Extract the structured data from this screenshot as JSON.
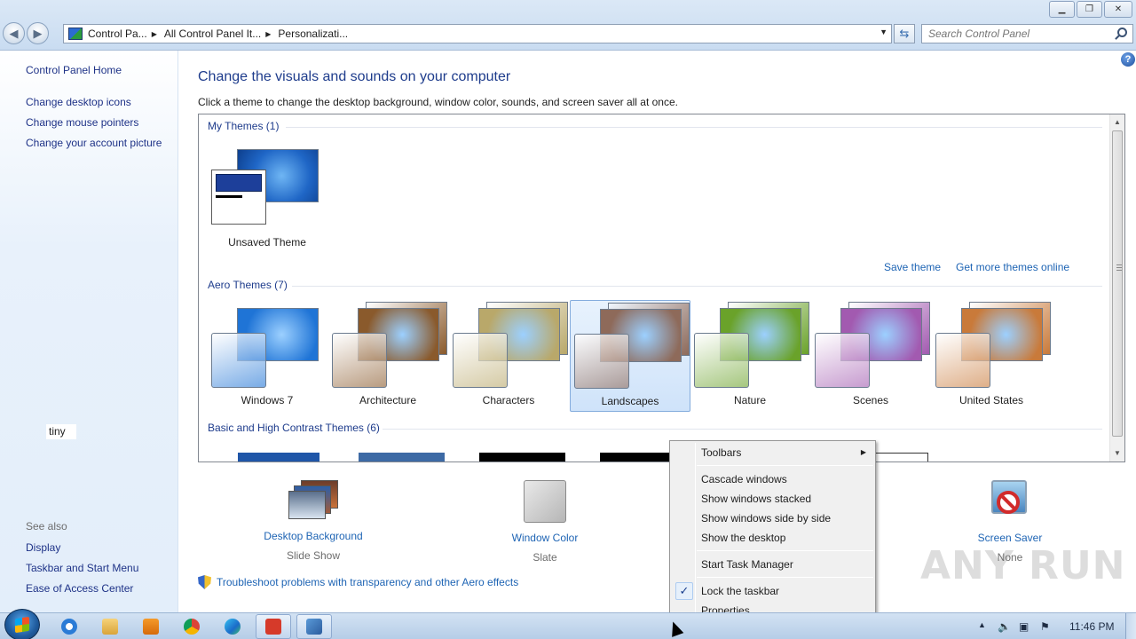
{
  "window": {
    "title_buttons": [
      "minimize",
      "maximize",
      "close"
    ]
  },
  "address": {
    "crumbs": [
      "Control Pa...",
      "All Control Panel It...",
      "Personalizati..."
    ],
    "search_placeholder": "Search Control Panel"
  },
  "sidebar": {
    "home": "Control Panel Home",
    "tasks": [
      "Change desktop icons",
      "Change mouse pointers",
      "Change your account picture"
    ],
    "tooltip_text": "tiny",
    "see_also_label": "See also",
    "see_also": [
      "Display",
      "Taskbar and Start Menu",
      "Ease of Access Center"
    ]
  },
  "main": {
    "title": "Change the visuals and sounds on your computer",
    "subtitle": "Click a theme to change the desktop background, window color, sounds, and screen saver all at once.",
    "groups": {
      "my_themes": "My Themes (1)",
      "aero_themes": "Aero Themes (7)",
      "basic_themes": "Basic and High Contrast Themes (6)"
    },
    "my_theme_name": "Unsaved Theme",
    "save_theme": "Save theme",
    "get_more": "Get more themes online",
    "aero_themes": [
      {
        "name": "Windows 7",
        "color": "#1f74d6"
      },
      {
        "name": "Architecture",
        "color": "#8a5a2c"
      },
      {
        "name": "Characters",
        "color": "#b9a86a"
      },
      {
        "name": "Landscapes",
        "color": "#8e6a5a",
        "selected": true
      },
      {
        "name": "Nature",
        "color": "#6aa22a"
      },
      {
        "name": "Scenes",
        "color": "#a25ab0"
      },
      {
        "name": "United States",
        "color": "#c97a3a"
      }
    ],
    "bottom": [
      {
        "label": "Desktop Background",
        "value": "Slide Show"
      },
      {
        "label": "Window Color",
        "value": "Slate"
      },
      {
        "label": "Screen Saver",
        "value": "None"
      }
    ],
    "troubleshoot": "Troubleshoot problems with transparency and other Aero effects",
    "watermark": "ANY RUN"
  },
  "context_menu": {
    "items": [
      {
        "label": "Toolbars",
        "submenu": true
      },
      {
        "label": "Cascade windows"
      },
      {
        "label": "Show windows stacked"
      },
      {
        "label": "Show windows side by side"
      },
      {
        "label": "Show the desktop"
      },
      {
        "label": "Start Task Manager"
      },
      {
        "label": "Lock the taskbar",
        "checked": true
      },
      {
        "label": "Properties"
      }
    ]
  },
  "taskbar": {
    "clock": "11:46 PM",
    "apps": [
      "internet-explorer",
      "file-explorer",
      "media-player",
      "chrome",
      "edge",
      "anyrun-app",
      "control-panel"
    ]
  }
}
